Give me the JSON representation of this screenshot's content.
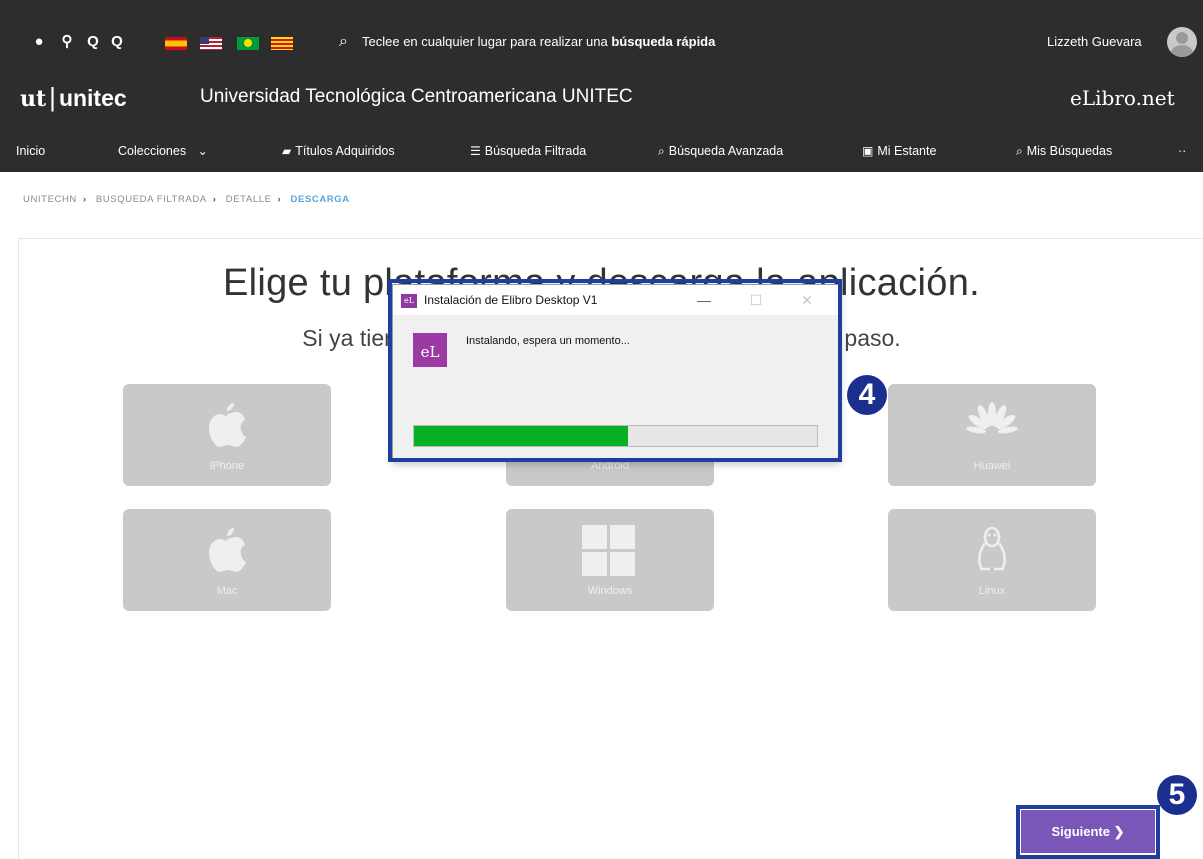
{
  "toolbar": {
    "icons": [
      "globe-icon",
      "link-icon",
      "zoom-out-icon",
      "zoom-in-icon"
    ],
    "flags": [
      "flag-spain-icon",
      "flag-usa-icon",
      "flag-brazil-icon",
      "flag-catalonia-icon"
    ],
    "search_prefix": "Teclee en cualquier lugar para realizar una ",
    "search_bold": "búsqueda rápida",
    "user_name": "Lizzeth Guevara"
  },
  "brand": {
    "logo_mark": "ut",
    "logo_name": "unitec",
    "university": "Universidad Tecnológica Centroamericana UNITEC",
    "product": "eLibro.net"
  },
  "nav": {
    "items": [
      {
        "label": "Inicio",
        "icon": ""
      },
      {
        "label": "Colecciones",
        "icon": "chevron-down-icon"
      },
      {
        "label": "Títulos Adquiridos",
        "icon": "book-icon"
      },
      {
        "label": "Búsqueda Filtrada",
        "icon": "filter-icon"
      },
      {
        "label": "Búsqueda Avanzada",
        "icon": "search-icon"
      },
      {
        "label": "Mi Estante",
        "icon": "shelf-icon"
      },
      {
        "label": "Mis Búsquedas",
        "icon": "search-icon"
      },
      {
        "label": "··",
        "icon": ""
      }
    ]
  },
  "breadcrumb": {
    "items": [
      "UNITECHN",
      "BUSQUEDA FILTRADA",
      "DETALLE"
    ],
    "active": "DESCARGA"
  },
  "main": {
    "headline": "Elige tu plataforma y descarga la aplicación.",
    "subline": "Si ya tienes la aplicación instalada, pasa al siguiente paso.",
    "platforms": [
      {
        "label": "iPhone",
        "icon": "apple-icon"
      },
      {
        "label": "Android",
        "icon": "android-icon"
      },
      {
        "label": "Huawei",
        "icon": "huawei-icon"
      },
      {
        "label": "Mac",
        "icon": "apple-icon"
      },
      {
        "label": "Windows",
        "icon": "windows-icon"
      },
      {
        "label": "Linux",
        "icon": "linux-icon"
      }
    ],
    "next_label": "Siguiente ❯"
  },
  "dialog": {
    "title": "Instalación de Elibro Desktop V1",
    "message": "Instalando, espera un momento...",
    "logo_text": "eL",
    "progress": 0.53,
    "minimize": "—",
    "maximize": "☐",
    "close": "✕"
  },
  "annotations": {
    "step4": "4",
    "step5": "5"
  },
  "colors": {
    "header_bg": "#2d2d2d",
    "accent_purple": "#7a56b8",
    "progress_green": "#06b025",
    "annotation_blue": "#1f3fa0"
  }
}
